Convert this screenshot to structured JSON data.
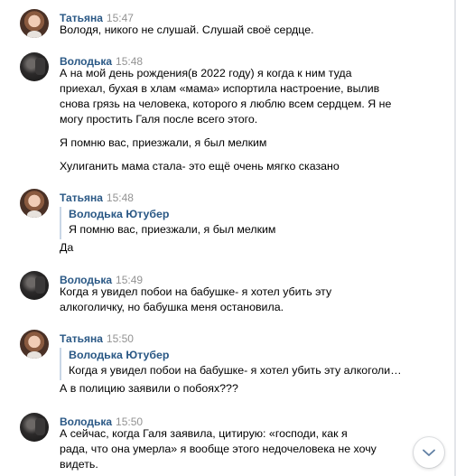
{
  "messages": [
    {
      "author": "Татьяна",
      "time": "15:47",
      "avatar": "tatiana-avatar",
      "lines": [
        "Володя, никого не слушай. Слушай своё сердце."
      ]
    },
    {
      "author": "Володька",
      "time": "15:48",
      "avatar": "volodka-avatar",
      "lines": [
        "А на мой день рождения(в 2022 году) я когда к ним туда",
        "приехал, бухая в хлам «мама» испортила настроение, вылив",
        "снова грязь на человека, которого я люблю всем сердцем. Я не",
        "могу простить Галя после всего этого.",
        "Я помню вас, приезжали, я был мелким",
        "Хулиганить мама стала- это ещё очень мягко сказано"
      ]
    },
    {
      "author": "Татьяна",
      "time": "15:48",
      "avatar": "tatiana-avatar",
      "quote": {
        "author": "Володька Ютубер",
        "text": "Я помню вас, приезжали, я был мелким"
      },
      "lines": [
        "Да"
      ]
    },
    {
      "author": "Володька",
      "time": "15:49",
      "avatar": "volodka-avatar",
      "lines": [
        "Когда я увидел побои на бабушке- я хотел убить эту",
        "алкоголичку, но бабушка меня остановила."
      ]
    },
    {
      "author": "Татьяна",
      "time": "15:50",
      "avatar": "tatiana-avatar",
      "quote": {
        "author": "Володька Ютубер",
        "text": "Когда я увидел побои на бабушке- я хотел убить эту алкоголи…"
      },
      "lines": [
        "А в полицию заявили о побоях???"
      ]
    },
    {
      "author": "Володька",
      "time": "15:50",
      "avatar": "volodka-avatar",
      "lines": [
        "А сейчас, когда Галя заявила, цитирую: «господи, как я",
        "рада, что она умерла» я вообще этого недочеловека не хочу",
        "видеть."
      ]
    }
  ],
  "scroll_button": {
    "icon": "chevron-down-icon"
  },
  "colors": {
    "author": "#2a5885",
    "time": "#939393",
    "quote_bar": "#c8d6e6"
  }
}
